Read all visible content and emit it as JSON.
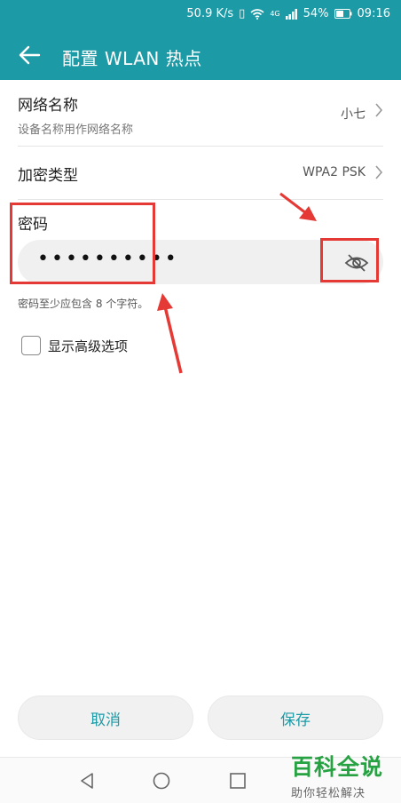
{
  "status_bar": {
    "speed": "50.9 K/s",
    "battery": "54%",
    "time": "09:16",
    "net_badge": "4G"
  },
  "app_bar": {
    "title": "配置 WLAN 热点",
    "back_icon": "arrow-left-icon"
  },
  "network_name": {
    "title": "网络名称",
    "subtitle": "设备名称用作网络名称",
    "value": "小七"
  },
  "encryption": {
    "title": "加密类型",
    "value": "WPA2 PSK"
  },
  "password": {
    "title": "密码",
    "masked_value": "••••••••••",
    "hint": "密码至少应包含 8 个字符。",
    "eye_icon": "eye-off-icon"
  },
  "advanced": {
    "label": "显示高级选项",
    "checked": false
  },
  "buttons": {
    "cancel": "取消",
    "save": "保存"
  },
  "watermark": {
    "main": "百科全说",
    "sub": "助你轻松解决"
  },
  "colors": {
    "accent": "#1c9aa6",
    "annotation": "#e53935",
    "watermark": "#27a243"
  }
}
